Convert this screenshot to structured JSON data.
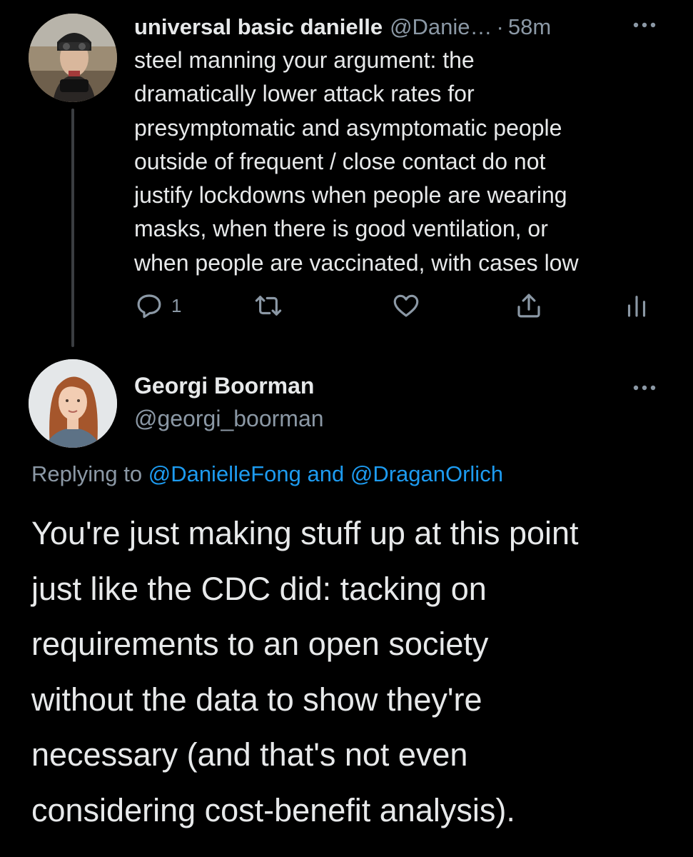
{
  "colors": {
    "background": "#000000",
    "text_primary": "#e7e9ea",
    "text_secondary": "#8b98a5",
    "link": "#1d9bf0",
    "thread_line": "#3a3d41"
  },
  "tweets": [
    {
      "author_name": "universal basic danielle",
      "author_handle": "@Danie…",
      "separator": "·",
      "timestamp": "58m",
      "avatar_icon": "user-avatar-photo",
      "more_icon": "more-horizontal-icon",
      "body": "steel manning your argument: the\ndramatically lower attack rates for\npresymptomatic and asymptomatic people\noutside of frequent / close contact do not\njustify lockdowns when people are wearing\nmasks, when there is good ventilation, or\nwhen people are vaccinated, with cases low",
      "actions": {
        "reply_count": "1",
        "reply_icon": "reply-icon",
        "retweet_icon": "retweet-icon",
        "like_icon": "heart-icon",
        "share_icon": "share-icon",
        "analytics_icon": "analytics-icon"
      }
    },
    {
      "author_name": "Georgi Boorman",
      "author_handle": "@georgi_boorman",
      "avatar_icon": "user-avatar-photo",
      "more_icon": "more-horizontal-icon",
      "replying_prefix": "Replying to",
      "replying_mention_1": "@DanielleFong",
      "replying_joiner": "and",
      "replying_mention_2": "@DraganOrlich",
      "body": "You're just making stuff up at this point\njust like the CDC did: tacking on\nrequirements to an open society\nwithout the data to show they're\nnecessary (and that's not even\nconsidering cost-benefit analysis)."
    }
  ]
}
